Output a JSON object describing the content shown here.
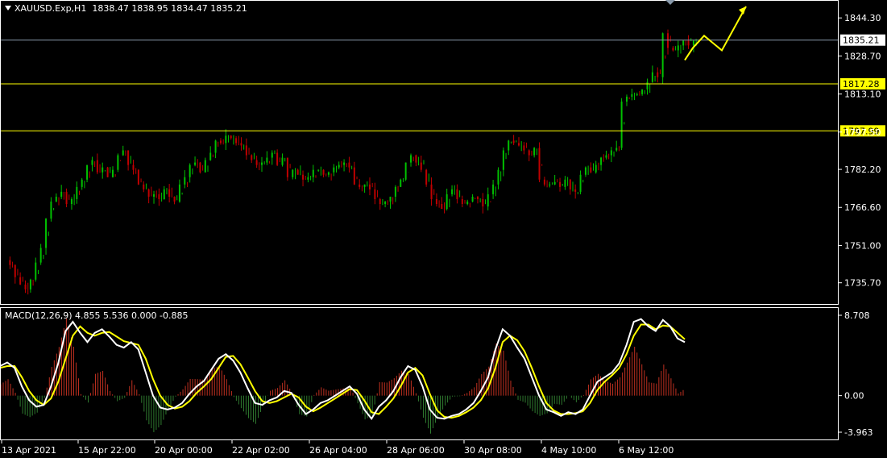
{
  "header": {
    "symbol": "XAUUSD.Exp,H1",
    "ohlc": "1838.47 1838.95 1834.47 1835.21"
  },
  "macd_header": {
    "label": "MACD(12,26,9) 4.855 5.536 0.000 -0.885"
  },
  "colors": {
    "background": "#000000",
    "bull_candle": "#00c000",
    "bear_candle": "#c00000",
    "hline": "#ffff00",
    "current_price_line": "#8899aa",
    "macd_line": "#ffffff",
    "signal_line": "#ffff00",
    "hist_pos": "#c03020",
    "hist_neg": "#2f7a2f",
    "arrow": "#ffff00",
    "axis": "#ffffff"
  },
  "chart_data": [
    {
      "type": "candlestick",
      "title": "XAUUSD.Exp,H1",
      "ylim": [
        1728,
        1849
      ],
      "y_ticks": [
        "1844.30",
        "1828.70",
        "1813.10",
        "1797.50",
        "1782.20",
        "1766.60",
        "1751.00",
        "1735.70"
      ],
      "x_ticks": [
        "13 Apr 2021",
        "15 Apr 22:00",
        "20 Apr 00:00",
        "22 Apr 02:00",
        "26 Apr 04:00",
        "28 Apr 06:00",
        "30 Apr 08:00",
        "4 May 10:00",
        "6 May 12:00"
      ],
      "horizontal_levels": [
        {
          "value": 1817.28,
          "label": "1817.28"
        },
        {
          "value": 1797.99,
          "label": "1797.99"
        }
      ],
      "current_price": {
        "value": 1835.21,
        "label": "1835.21"
      },
      "path_closes": [
        1745,
        1743,
        1738,
        1735,
        1733,
        1737,
        1744,
        1750,
        1762,
        1769,
        1771,
        1773,
        1768,
        1770,
        1775,
        1778,
        1784,
        1786,
        1781,
        1783,
        1779,
        1782,
        1788,
        1790,
        1784,
        1782,
        1776,
        1774,
        1771,
        1772,
        1770,
        1774,
        1771,
        1769,
        1776,
        1779,
        1784,
        1785,
        1781,
        1786,
        1789,
        1794,
        1793,
        1796,
        1795,
        1793,
        1792,
        1788,
        1786,
        1784,
        1785,
        1787,
        1789,
        1784,
        1787,
        1779,
        1782,
        1780,
        1778,
        1779,
        1782,
        1782,
        1780,
        1781,
        1783,
        1784,
        1785,
        1783,
        1776,
        1775,
        1776,
        1774,
        1770,
        1768,
        1769,
        1771,
        1775,
        1778,
        1785,
        1788,
        1785,
        1782,
        1776,
        1770,
        1768,
        1766,
        1772,
        1774,
        1770,
        1768,
        1769,
        1771,
        1770,
        1767,
        1772,
        1776,
        1782,
        1790,
        1794,
        1793,
        1792,
        1790,
        1788,
        1791,
        1778,
        1776,
        1776,
        1777,
        1775,
        1778,
        1774,
        1773,
        1780,
        1783,
        1781,
        1784,
        1787,
        1788,
        1790,
        1791,
        1810,
        1812,
        1813,
        1813,
        1815,
        1818,
        1822,
        1820,
        1838,
        1832,
        1831,
        1833,
        1835,
        1833,
        1835
      ],
      "projection_arrow": [
        [
          1835,
          1827
        ],
        [
          1838,
          1832
        ],
        [
          1843,
          1837
        ],
        [
          1848,
          1831
        ],
        [
          1853,
          1849
        ]
      ]
    },
    {
      "type": "line",
      "title": "MACD(12,26,9) 4.855 5.536 0.000 -0.885",
      "ylim": [
        -3.963,
        8.708
      ],
      "y_ticks": [
        "8.708",
        "0.00",
        "-3.963"
      ],
      "series": [
        {
          "values": [
            3.2,
            3.6,
            3.0,
            1.0,
            -0.5,
            -1.2,
            -1.0,
            1.0,
            3.5,
            7.0,
            8.0,
            6.8,
            5.8,
            6.8,
            7.2,
            6.4,
            5.5,
            5.2,
            5.8,
            5.0,
            2.5,
            0.0,
            -1.3,
            -1.5,
            -1.3,
            -0.8,
            0.2,
            1.0,
            1.6,
            2.8,
            4.0,
            4.5,
            3.8,
            2.5,
            0.8,
            -0.8,
            -1.0,
            -0.5,
            -0.2,
            0.5,
            0.3,
            -1.0,
            -2.0,
            -1.5,
            -0.8,
            -0.5,
            0.0,
            0.5,
            1.0,
            0.2,
            -1.5,
            -2.5,
            -1.2,
            -0.5,
            0.5,
            2.0,
            3.2,
            2.8,
            1.0,
            -1.5,
            -2.4,
            -2.5,
            -2.2,
            -2.0,
            -1.5,
            -0.8,
            0.5,
            2.0,
            5.0,
            7.2,
            6.5,
            5.2,
            4.0,
            2.0,
            0.0,
            -1.5,
            -1.8,
            -2.2,
            -1.8,
            -2.0,
            -1.5,
            0.0,
            1.5,
            2.0,
            2.5,
            3.5,
            5.5,
            8.0,
            8.3,
            7.5,
            7.0,
            8.2,
            7.5,
            6.2,
            5.8
          ]
        },
        {
          "values": [
            3.0,
            3.2,
            3.2,
            2.0,
            0.5,
            -0.5,
            -1.0,
            -0.3,
            1.5,
            4.0,
            6.5,
            7.5,
            6.8,
            6.5,
            6.8,
            6.9,
            6.4,
            5.9,
            5.7,
            5.5,
            4.0,
            1.8,
            0.0,
            -1.0,
            -1.4,
            -1.2,
            -0.6,
            0.3,
            1.0,
            1.8,
            3.0,
            4.2,
            4.3,
            3.4,
            2.0,
            0.5,
            -0.6,
            -0.8,
            -0.6,
            -0.2,
            0.2,
            -0.2,
            -1.2,
            -1.7,
            -1.3,
            -0.8,
            -0.3,
            0.2,
            0.7,
            0.6,
            -0.5,
            -1.8,
            -2.0,
            -1.2,
            -0.3,
            1.0,
            2.5,
            3.0,
            2.2,
            0.2,
            -1.6,
            -2.3,
            -2.4,
            -2.2,
            -1.8,
            -1.3,
            -0.5,
            0.8,
            3.0,
            5.8,
            6.5,
            6.0,
            4.8,
            3.0,
            1.0,
            -0.8,
            -1.6,
            -2.0,
            -2.0,
            -1.9,
            -1.7,
            -0.8,
            0.6,
            1.5,
            2.2,
            3.0,
            4.5,
            6.5,
            7.7,
            7.7,
            7.2,
            7.6,
            7.5,
            6.8,
            6.1
          ]
        }
      ]
    }
  ]
}
